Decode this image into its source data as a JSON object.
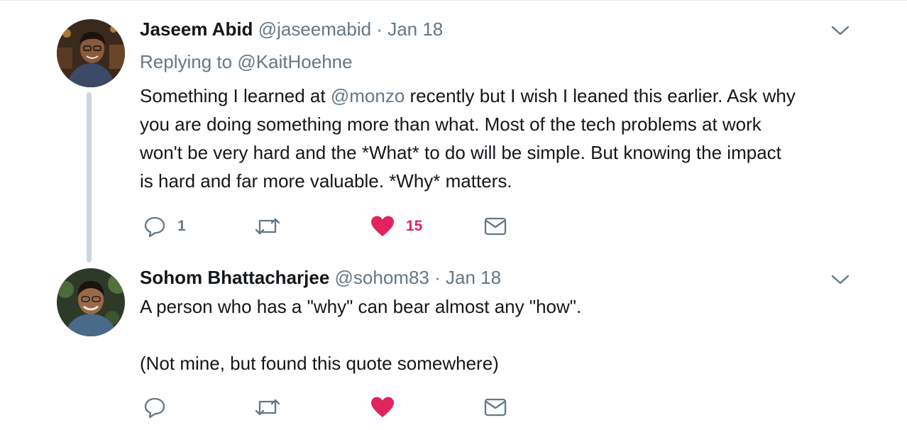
{
  "tweets": [
    {
      "author_name": "Jaseem Abid",
      "handle": "@jaseemabid",
      "separator": "·",
      "date": "Jan 18",
      "replying_prefix": "Replying to ",
      "replying_to": "@KaitHoehne",
      "text_lines": [
        [
          "Something I learned at ",
          "@monzo",
          " recently but I wish I leaned this earlier. Ask why"
        ],
        "you are doing something more than what. Most of the tech problems at work",
        "won't be very hard and the *What* to do will be simple. But knowing the impact",
        "is hard and far more valuable. *Why* matters."
      ],
      "reply_count": "1",
      "retweet_count": "",
      "like_count": "15"
    },
    {
      "author_name": "Sohom Bhattacharjee",
      "handle": "@sohom83",
      "separator": "·",
      "date": "Jan 18",
      "text_lines": [
        "A person who has a \"why\" can bear almost any \"how\".",
        "",
        "(Not mine, but found this quote somewhere)"
      ],
      "reply_count": "",
      "retweet_count": "",
      "like_count": ""
    }
  ],
  "icons": {
    "reply": "reply-icon",
    "retweet": "retweet-icon",
    "like": "heart-icon",
    "message": "envelope-icon",
    "more": "chevron-down-icon"
  },
  "colors": {
    "name": "#14171a",
    "secondary": "#657786",
    "like_active": "#e0245e",
    "thread_line": "#ccd6dd"
  }
}
